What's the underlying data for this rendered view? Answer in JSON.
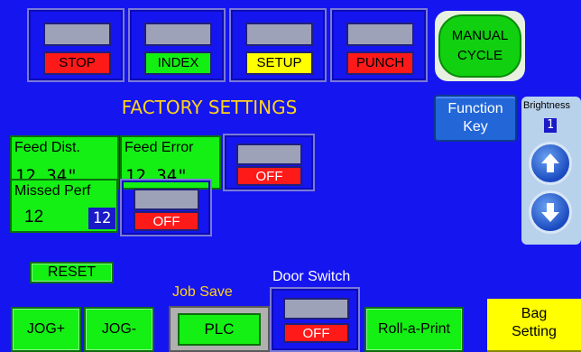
{
  "top_buttons": [
    {
      "label": "STOP",
      "color": "#ff1a1a"
    },
    {
      "label": "INDEX",
      "color": "#12f012"
    },
    {
      "label": "SETUP",
      "color": "#ffff00"
    },
    {
      "label": "PUNCH",
      "color": "#ff1a1a"
    }
  ],
  "manual_cycle": {
    "line1": "MANUAL",
    "line2": "CYCLE"
  },
  "title": "FACTORY SETTINGS",
  "function_key": {
    "line1": "Function",
    "line2": "Key"
  },
  "brightness": {
    "label": "Brightness",
    "value": "1",
    "up_icon": "arrow-up-icon",
    "down_icon": "arrow-down-icon"
  },
  "feed_dist": {
    "label": "Feed Dist.",
    "value": "12.34\""
  },
  "feed_error": {
    "label": "Feed Error",
    "value": "12.34\""
  },
  "feed_toggle": {
    "state": "OFF"
  },
  "missed_perf": {
    "label": "Missed Perf",
    "value": "12",
    "limit": "12"
  },
  "missed_toggle": {
    "state": "OFF"
  },
  "reset": {
    "label": "RESET"
  },
  "bottom": {
    "jog_plus": "JOG+",
    "jog_minus": "JOG-",
    "job_save_label": "Job Save",
    "plc": "PLC",
    "door_switch_label": "Door Switch",
    "door_switch_state": "OFF",
    "roll_a_print": "Roll-a-Print",
    "bag_setting_line1": "Bag",
    "bag_setting_line2": "Setting"
  }
}
